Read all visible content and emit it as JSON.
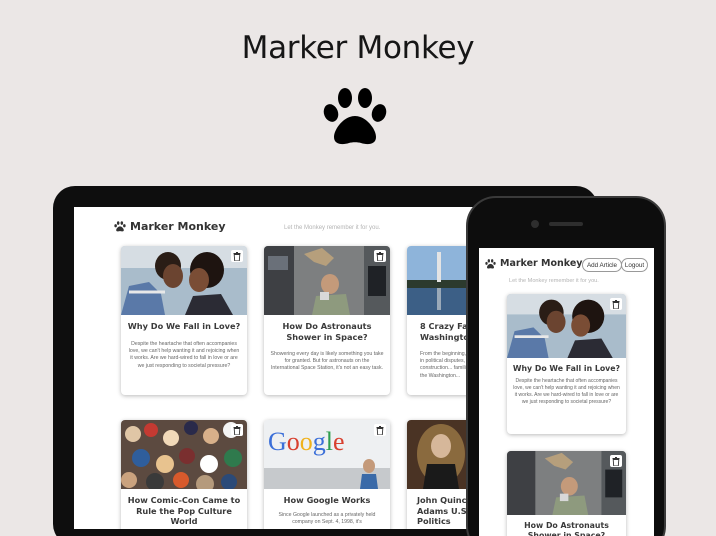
{
  "hero": {
    "title": "Marker Monkey"
  },
  "app": {
    "brand": "Marker Monkey",
    "tagline": "Let the Monkey remember it for you."
  },
  "phone_nav": {
    "add_article": "Add Article",
    "logout": "Logout"
  },
  "articles": [
    {
      "title": "Why Do We Fall in Love?",
      "summary": "Despite the heartache that often accompanies love, we can't help wanting it and rejoicing when it works. Are we hard-wired to fall in love or are we just responding to societal pressure?"
    },
    {
      "title": "How Do Astronauts Shower in Space?",
      "summary": "Showering every day is likely something you take for granted. But for astronauts on the International Space Station, it's not an easy task."
    },
    {
      "title": "8 Crazy Facts About Washington",
      "summary": "From the beginning, the monument was mired in political disputes, lack of funds and construction... familiar? Find out more about the Washington..."
    },
    {
      "title": "How Comic-Con Came to Rule the Pop Culture World",
      "summary": ""
    },
    {
      "title": "How Google Works",
      "summary": "Since Google launched as a privately held company on Sept. 4, 1998, it's"
    },
    {
      "title": "John Quincy Adams U.S. Politics",
      "summary": ""
    }
  ],
  "colors": {
    "background": "#ebe7e6",
    "device": "#0e0e0e",
    "screen": "#ffffff"
  }
}
